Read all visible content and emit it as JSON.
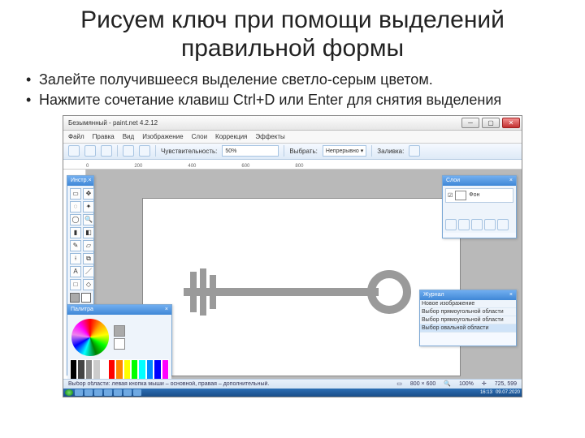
{
  "title": "Рисуем ключ при помощи выделений правильной формы",
  "bullets": [
    "Залейте получившееся выделение светло-серым цветом.",
    "Нажмите сочетание клавиш Ctrl+D или Enter для снятия выделения"
  ],
  "app": {
    "window_title": "Безымянный - paint.net 4.2.12",
    "menus": [
      "Файл",
      "Правка",
      "Вид",
      "Изображение",
      "Слои",
      "Коррекция",
      "Эффекты"
    ],
    "toolbar": {
      "tolerance_label": "Чувствительность:",
      "tolerance_value": "50%",
      "mode_label": "Выбрать:",
      "mode_value": "Непрерывно",
      "flood_label": "Заливка:"
    },
    "ruler_marks": [
      "0",
      "200",
      "400",
      "600",
      "800"
    ],
    "panels": {
      "tools_title": "Инстр.",
      "layers_title": "Слои",
      "layer_name": "Фон",
      "journal_title": "Журнал",
      "journal_items": [
        "Новое изображение",
        "Выбор прямоугольной области",
        "Выбор прямоугольной области",
        "Выбор овальной области"
      ],
      "palette_title": "Палитра"
    },
    "statusbar": {
      "hint": "Выбор области: левая кнопка мыши – основной, правая – дополнительный.",
      "size": "800 × 600",
      "zoom": "100%",
      "coords": "725, 599"
    },
    "taskbar": {
      "time": "16:13",
      "date": "09.07.2020"
    }
  }
}
